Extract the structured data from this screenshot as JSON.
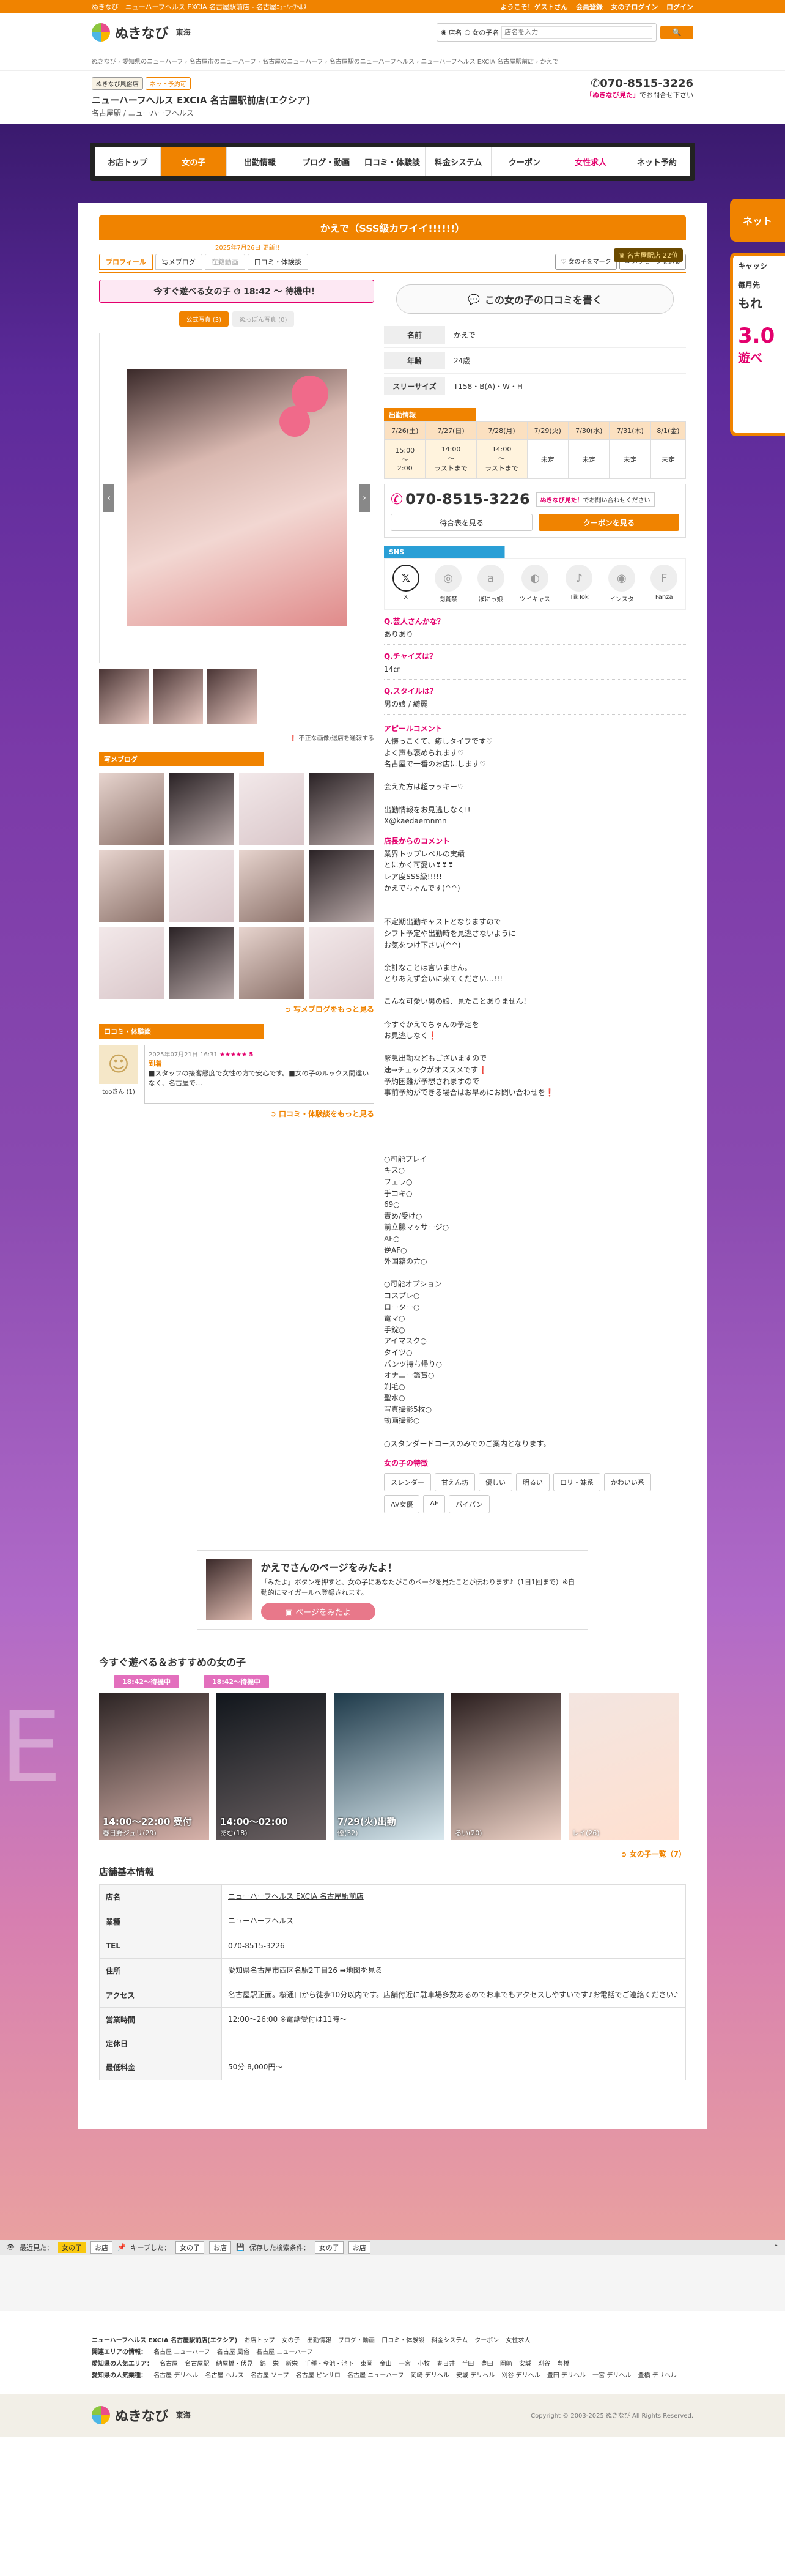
{
  "topbar": {
    "text": "ぬきなび｜ニューハーフヘルス EXCIA 名古屋駅前店 - 名古屋ﾆｭｰﾊｰﾌﾍﾙｽ",
    "welcome": "ようこそ！ゲストさん",
    "register": "会員登録",
    "login_girl": "女の子ログイン",
    "login": "ログイン"
  },
  "header": {
    "logo": "ぬきなび",
    "region": "東海",
    "radio_shop": "店名",
    "radio_girl": "女の子名",
    "search_placeholder": "店名を入力",
    "search_button": "検索"
  },
  "breadcrumb": [
    "ぬきなび",
    "愛知県のニューハーフ",
    "名古屋市のニューハーフ",
    "名古屋のニューハーフ",
    "名古屋駅のニューハーフヘルス",
    "ニューハーフヘルス EXCIA 名古屋駅前店",
    "かえで"
  ],
  "shop": {
    "badge1": "ぬきなび風俗店",
    "badge2": "ネット予約可",
    "name": "ニューハーフヘルス EXCIA 名古屋駅前店(エクシア)",
    "sub": "名古屋駅 / ニューハーフヘルス",
    "tel": "070-8515-3226",
    "tel_note_b": "「ぬきなび見た」",
    "tel_note": "でお問合せ下さい"
  },
  "nav": [
    {
      "label": "お店トップ"
    },
    {
      "label": "女の子"
    },
    {
      "label": "出勤情報"
    },
    {
      "label": "ブログ・動画"
    },
    {
      "label": "口コミ・体験談"
    },
    {
      "label": "料金システム"
    },
    {
      "label": "クーポン"
    },
    {
      "label": "女性求人"
    },
    {
      "label": "ネット予約"
    }
  ],
  "side": {
    "tab": "ネット",
    "cash_title": "キャッシ",
    "cash_sub": "毎月先",
    "cash_big": "もれ",
    "cash_rate": "3.0",
    "cash_end": "遊べ"
  },
  "girl": {
    "title": "かえで（SSS級カワイイ!!!!!!）",
    "updated": "2025年7月26日 更新!!",
    "rank": "名古屋駅店 22位",
    "tabs": [
      "プロフィール",
      "写メブログ",
      "在籍動画",
      "口コミ・体験談"
    ],
    "btn_page": "女の子をマーク",
    "btn_msg": "メッセージを送る",
    "today": "今すぐ遊べる女の子",
    "today_time": "18:42 〜 待機中！",
    "photo_tab1": "公式写真 (3)",
    "photo_tab2": "ぬっぽん写真 (0)",
    "report": "不正な画像/退店を通報する",
    "blog_head": "写メブログ",
    "blog_more": "写メブログをもっと見る",
    "review_head": "口コミ・体験談",
    "reviewer": "tooさん (1)",
    "review_date": "2025年07月21日 16:31",
    "review_stars": "★★★★★ 5",
    "review_title": "到着",
    "review_body": "■スタッフの接客態度で女性の方で安心です。■女の子のルックス間違いなく、名古屋で…",
    "review_more": "口コミ・体験談をもっと見る",
    "review_button": "この女の子の口コミを書く",
    "profile": [
      {
        "k": "名前",
        "v": "かえで"
      },
      {
        "k": "年齢",
        "v": "24歳"
      },
      {
        "k": "スリーサイズ",
        "v": "T158・B(A)・W・H"
      }
    ],
    "sched_head": "出勤情報",
    "sched_days": [
      "7/26(土)",
      "7/27(日)",
      "7/28(月)",
      "7/29(火)",
      "7/30(水)",
      "7/31(木)",
      "8/1(金)"
    ],
    "sched_times": [
      "15:00\n〜\n2:00",
      "14:00\n〜\nラストまで",
      "14:00\n〜\nラストまで",
      "未定",
      "未定",
      "未定",
      "未定"
    ],
    "call_tel": "070-8515-3226",
    "call_note_b": "ぬきなび見た！",
    "call_note": "でお問い合わせください",
    "call_btn1": "待合表を見る",
    "call_btn2": "クーポンを見る",
    "sns_head": "SNS",
    "sns": [
      "X",
      "閲覧禁",
      "ぽにっ娘",
      "ツイキャス",
      "TikTok",
      "インスタ",
      "Fanza"
    ],
    "q1": "Q.芸人さんかな？",
    "a1": "ありあり",
    "q2": "Q.チャイズは？",
    "a2": "14㎝",
    "q3": "Q.スタイルは？",
    "a3": "男の娘 / 綺麗",
    "appeal_title": "アピールコメント",
    "appeal": "人懐っこくて、癒しタイプです♡\nよく声も褒められます♡\n名古屋で一番のお店にします♡\n\n会えた方は超ラッキー♡\n\n出勤情報をお見逃しなく!!\nX@kaedaemnmn",
    "shop_title": "店長からのコメント",
    "shop_comment": "業界トップレベルの実績\nとにかく可愛い❣❣❣\nレア度SSS級!!!!!\nかえでちゃんです(^^)\n\n\n不定期出勤キャストとなりますので\nシフト予定や出勤時を見逃さないように\nお気をつけ下さい(^^)\n\n余計なことは言いません。\nとりあえず会いに来てください…!!!\n\nこんな可愛い男の娘、見たことありません！\n\n今すぐかえでちゃんの予定を\nお見逃しなく❗\n\n緊急出勤などもございますので\n速→チェックがオススメです❗\n予約困難が予想されますので\n事前予約ができる場合はお早めにお問い合わせを❗",
    "play_list": "○可能プレイ\nキス○\nフェラ○\n手コキ○\n69○\n責め/受け○\n前立腺マッサージ○\nAF○\n逆AF○\n外国籍の方○\n\n○可能オプション\nコスプレ○\nローター○\n電マ○\n手錠○\nアイマスク○\nタイツ○\nパンツ持ち帰り○\nオナニー鑑賞○\n剃毛○\n聖水○\n写真撮影5枚○\n動画撮影○\n\n○スタンダードコースのみでのご案内となります。",
    "type_title": "女の子の特徴",
    "tags": [
      "スレンダー",
      "甘えん坊",
      "優しい",
      "明るい",
      "ロリ・妹系",
      "かわいい系",
      "AV女優",
      "AF",
      "パイパン"
    ]
  },
  "bookmark": {
    "title": "かえでさんのページをみたよ！",
    "desc": "「みたよ」ボタンを押すと、女の子にあなたがこのページを見たことが伝わります♪（1日1回まで）※自動的にマイガールへ登録されます。",
    "button": "ページをみたよ"
  },
  "recommend": {
    "title": "今すぐ遊べる＆おすすめの女の子",
    "wait1": "18:42〜待機中",
    "wait2": "18:42〜待機中",
    "girls": [
      {
        "time": "14:00〜22:00 受付",
        "name": "春日野ジュリ(29)"
      },
      {
        "time": "14:00〜02:00",
        "name": "あむ(18)"
      },
      {
        "time": "7/29(火)出勤",
        "name": "優(32)"
      },
      {
        "time": "",
        "name": "るい(20)"
      },
      {
        "time": "",
        "name": "レイ(26)"
      }
    ],
    "more": "女の子一覧（7）"
  },
  "info": {
    "title": "店舗基本情報",
    "rows": [
      {
        "k": "店名",
        "v": "ニューハーフヘルス EXCIA 名古屋駅前店"
      },
      {
        "k": "業種",
        "v": "ニューハーフヘルス"
      },
      {
        "k": "TEL",
        "v": "070-8515-3226"
      },
      {
        "k": "住所",
        "v": "愛知県名古屋市西区名駅2丁目26 ➡地図を見る"
      },
      {
        "k": "アクセス",
        "v": "名古屋駅正面。桜通口から徒歩10分以内です。店舗付近に駐車場多数あるのでお車でもアクセスしやすいです♪お電話でご連絡ください♪"
      },
      {
        "k": "営業時間",
        "v": "12:00〜26:00 ※電話受付は11時〜"
      },
      {
        "k": "定休日",
        "v": ""
      },
      {
        "k": "最低料金",
        "v": "50分 8,000円〜"
      }
    ]
  },
  "history": {
    "label1": "最近見た：",
    "h1": "女の子",
    "h2": "お店",
    "label2": "キープした：",
    "k1": "女の子",
    "k2": "お店",
    "label3": "保存した検索条件：",
    "s1": "女の子",
    "s2": "お店"
  },
  "footer": {
    "line1_b": "ニューハーフヘルス EXCIA 名古屋駅前店(エクシア)",
    "line1": [
      "お店トップ",
      "女の子",
      "出勤情報",
      "ブログ・動画",
      "口コミ・体験談",
      "料金システム",
      "クーポン",
      "女性求人"
    ],
    "line2_b": "関連エリアの情報：",
    "line2": [
      "名古屋 ニューハーフ",
      "名古屋 風俗",
      "名古屋 ニューハーフ"
    ],
    "line3_b": "愛知県の人気エリア：",
    "line3": [
      "名古屋",
      "名古屋駅",
      "納屋橋・伏見",
      "錦",
      "栄",
      "新栄",
      "千種・今池・池下",
      "東岡",
      "金山",
      "一宮",
      "小牧",
      "春日井",
      "半田",
      "豊田",
      "岡崎",
      "安城",
      "刈谷",
      "豊橋"
    ],
    "line4_b": "愛知県の人気業種：",
    "line4": [
      "名古屋 デリヘル",
      "名古屋 ヘルス",
      "名古屋 ソープ",
      "名古屋 ピンサロ",
      "名古屋 ニューハーフ",
      "岡崎 デリヘル",
      "安城 デリヘル",
      "刈谷 デリヘル",
      "豊田 デリヘル",
      "一宮 デリヘル",
      "豊橋 デリヘル"
    ],
    "logo": "ぬきなび",
    "region": "東海",
    "copyright": "Copyright © 2003-2025 ぬきなび All Rights Reserved."
  }
}
